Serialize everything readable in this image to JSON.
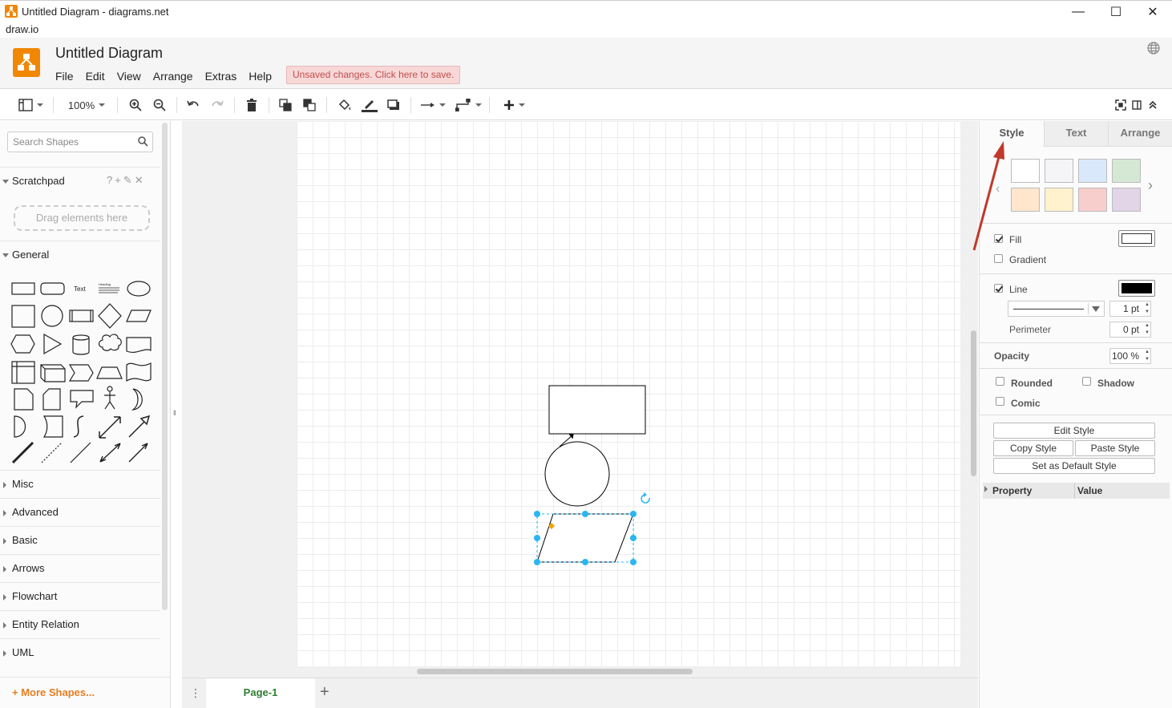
{
  "window": {
    "title": "Untitled Diagram - diagrams.net",
    "minimize_glyph": "—",
    "maximize_glyph": "☐",
    "close_glyph": "✕"
  },
  "app_label": "draw.io",
  "header": {
    "doc_title": "Untitled Diagram",
    "menus": [
      "File",
      "Edit",
      "View",
      "Arrange",
      "Extras",
      "Help"
    ],
    "unsaved_notice": "Unsaved changes. Click here to save."
  },
  "toolbar": {
    "zoom": "100%"
  },
  "sidebar": {
    "search_placeholder": "Search Shapes",
    "scratchpad_label": "Scratchpad",
    "scratchpad_tools": "?+✎✕",
    "drag_hint": "Drag elements here",
    "general_label": "General",
    "sections": [
      "Misc",
      "Advanced",
      "Basic",
      "Arrows",
      "Flowchart",
      "Entity Relation",
      "UML"
    ],
    "more_shapes": "More Shapes...",
    "text_shape_label": "Text",
    "heading_shape_label": "Heading"
  },
  "pages": {
    "active": "Page-1"
  },
  "format_panel": {
    "tabs": [
      "Style",
      "Text",
      "Arrange"
    ],
    "swatches": [
      "#ffffff",
      "#f5f5f7",
      "#dae8fc",
      "#d5e8d4",
      "#ffe6cc",
      "#fff2cc",
      "#f8cecc",
      "#e1d5e7"
    ],
    "fill_label": "Fill",
    "fill_color": "#ffffff",
    "gradient_label": "Gradient",
    "line_label": "Line",
    "line_color": "#000000",
    "line_width": "1 pt",
    "perimeter_label": "Perimeter",
    "perimeter_value": "0 pt",
    "opacity_label": "Opacity",
    "opacity_value": "100 %",
    "rounded_label": "Rounded",
    "shadow_label": "Shadow",
    "comic_label": "Comic",
    "edit_style": "Edit Style",
    "copy_style": "Copy Style",
    "paste_style": "Paste Style",
    "default_style": "Set as Default Style",
    "property_header": "Property",
    "value_header": "Value"
  },
  "colors": {
    "accent_orange": "#f08705",
    "selection_blue": "#29b6f2",
    "page_tab_green": "#2e7d32",
    "annotation_arrow": "#c0392b"
  }
}
